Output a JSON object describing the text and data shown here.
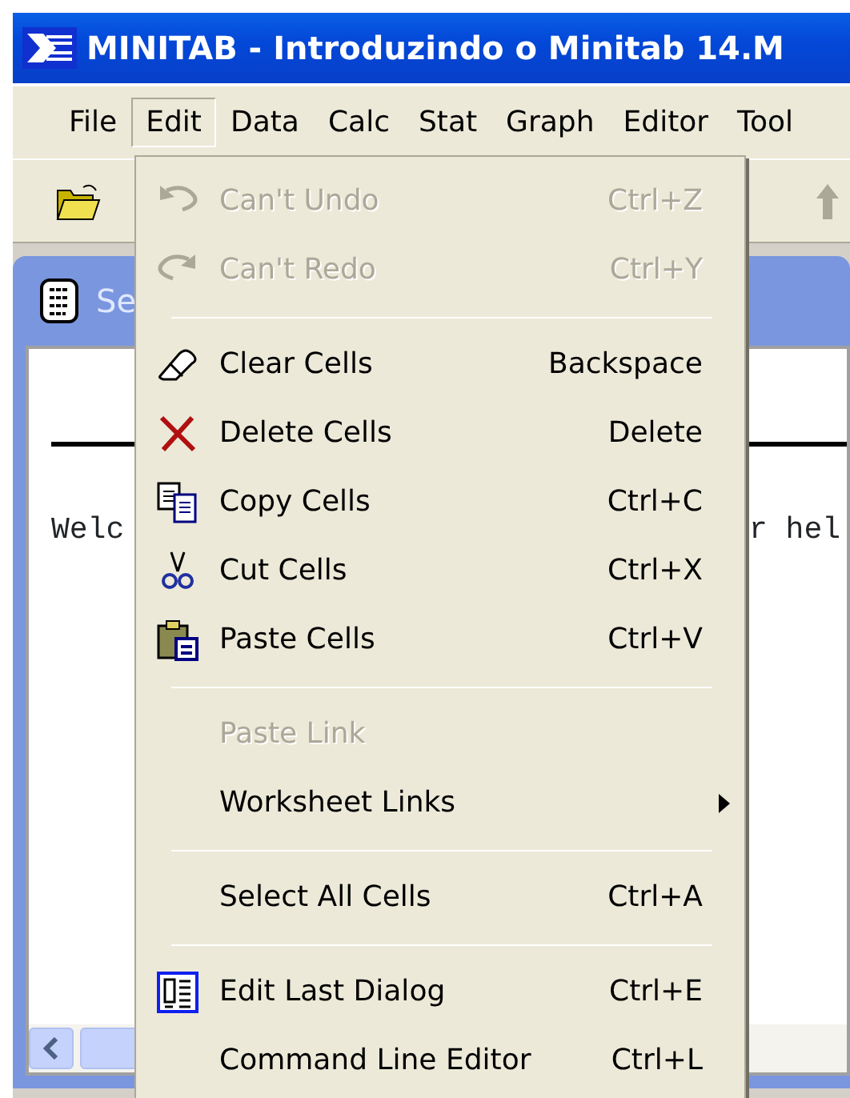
{
  "window": {
    "title": "MINITAB - Introduzindo o Minitab 14.M"
  },
  "menubar": [
    {
      "label": "File",
      "selected": false
    },
    {
      "label": "Edit",
      "selected": true
    },
    {
      "label": "Data",
      "selected": false
    },
    {
      "label": "Calc",
      "selected": false
    },
    {
      "label": "Stat",
      "selected": false
    },
    {
      "label": "Graph",
      "selected": false
    },
    {
      "label": "Editor",
      "selected": false
    },
    {
      "label": "Tool",
      "selected": false
    }
  ],
  "session_window": {
    "title": "Se",
    "text_left": "Welc",
    "text_right": "r hel"
  },
  "edit_menu": {
    "items": [
      {
        "kind": "item",
        "label": "Can't Undo",
        "shortcut": "Ctrl+Z",
        "disabled": true
      },
      {
        "kind": "item",
        "label": "Can't Redo",
        "shortcut": "Ctrl+Y",
        "disabled": true
      },
      {
        "kind": "separator"
      },
      {
        "kind": "item",
        "label": "Clear Cells",
        "shortcut": "Backspace",
        "disabled": false
      },
      {
        "kind": "item",
        "label": "Delete Cells",
        "shortcut": "Delete",
        "disabled": false
      },
      {
        "kind": "item",
        "label": "Copy Cells",
        "shortcut": "Ctrl+C",
        "disabled": false
      },
      {
        "kind": "item",
        "label": "Cut Cells",
        "shortcut": "Ctrl+X",
        "disabled": false
      },
      {
        "kind": "item",
        "label": "Paste Cells",
        "shortcut": "Ctrl+V",
        "disabled": false
      },
      {
        "kind": "separator"
      },
      {
        "kind": "item",
        "label": "Paste Link",
        "disabled": true
      },
      {
        "kind": "submenu",
        "label": "Worksheet Links",
        "disabled": false
      },
      {
        "kind": "separator"
      },
      {
        "kind": "item",
        "label": "Select All Cells",
        "shortcut": "Ctrl+A",
        "disabled": false
      },
      {
        "kind": "separator"
      },
      {
        "kind": "item",
        "label": "Edit Last Dialog",
        "shortcut": "Ctrl+E",
        "disabled": false
      },
      {
        "kind": "item",
        "label": "Command Line Editor",
        "shortcut": "Ctrl+L",
        "disabled": false
      }
    ]
  }
}
